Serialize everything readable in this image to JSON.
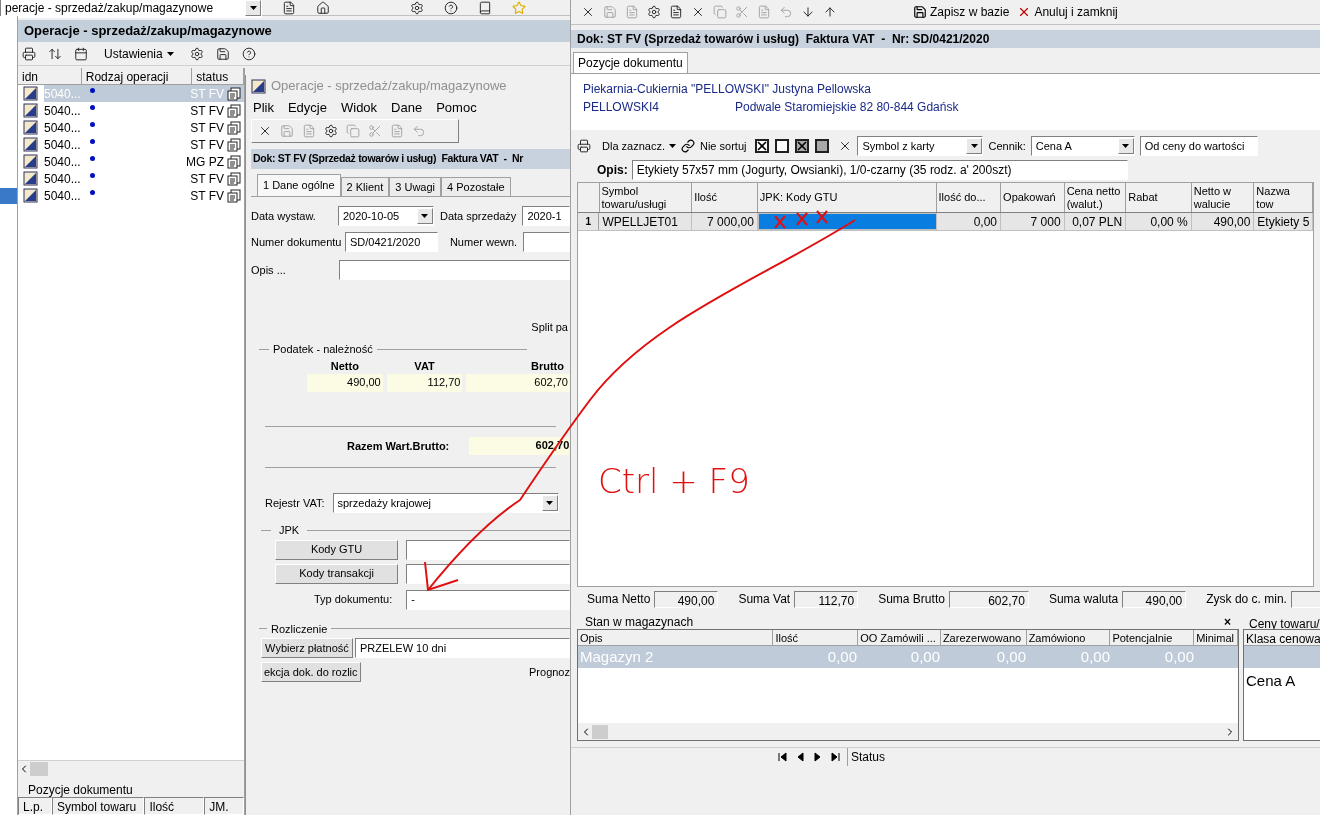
{
  "top_bar": {
    "combo_value": "peracje - sprzedaż/zakup/magazynowe"
  },
  "left_window": {
    "title": "Operacje - sprzedaż/zakup/magazynowe",
    "settings_label": "Ustawienia",
    "columns": [
      "idn",
      "Rodzaj operacji",
      "status"
    ],
    "rows": [
      {
        "idn": "5040...",
        "type": "ST FV",
        "selected": true
      },
      {
        "idn": "5040...",
        "type": "ST FV",
        "selected": false
      },
      {
        "idn": "5040...",
        "type": "ST FV",
        "selected": false
      },
      {
        "idn": "5040...",
        "type": "ST FV",
        "selected": false
      },
      {
        "idn": "5040...",
        "type": "MG PZ",
        "selected": false
      },
      {
        "idn": "5040...",
        "type": "ST FV",
        "selected": false
      },
      {
        "idn": "5040...",
        "type": "ST FV",
        "selected": false
      }
    ],
    "bottom_panel": {
      "title": "Pozycje dokumentu",
      "columns": [
        "L.p.",
        "Symbol towaru",
        "Ilość",
        "JM."
      ]
    }
  },
  "document_window": {
    "title": "Operacje - sprzedaż/zakup/magazynowe",
    "menu": [
      "Plik",
      "Edycje",
      "Widok",
      "Dane",
      "Pomoc"
    ],
    "header": "Dok: ST FV (Sprzedaż towarów i usług)  Faktura VAT  -  Nr",
    "tabs": [
      {
        "label": "1 Dane ogólne",
        "selected": true
      },
      {
        "label": "2 Klient",
        "selected": false
      },
      {
        "label": "3 Uwagi",
        "selected": false
      },
      {
        "label": "4 Pozostałe",
        "selected": false
      }
    ],
    "issue_date": {
      "label": "Data wystaw.",
      "value": "2020-10-05"
    },
    "sale_date": {
      "label": "Data sprzedaży",
      "value": "2020-1"
    },
    "doc_number": {
      "label": "Numer dokumentu",
      "value": "SD/0421/2020"
    },
    "internal_number": {
      "label": "Numer wewn."
    },
    "description": {
      "label": "Opis ..."
    },
    "split_label": "Split pa",
    "tax": {
      "title": "Podatek - należność",
      "columns": [
        "Netto",
        "VAT",
        "Brutto"
      ],
      "values": [
        "490,00",
        "112,70",
        "602,70"
      ],
      "total_label": "Razem Wart.Brutto:",
      "total": "602,70"
    },
    "vat_register": {
      "label": "Rejestr VAT:",
      "value": "sprzedaży krajowej"
    },
    "jpk": {
      "title": "JPK",
      "gtu_button": "Kody GTU",
      "transaction_button": "Kody transakcji",
      "doc_type_label": "Typ dokumentu:",
      "doc_type_value": "-"
    },
    "settlement": {
      "title": "Rozliczenie",
      "payment_button": "Wybierz płatność",
      "payment_value": "PRZELEW 10 dni",
      "selection_button": "ekcja dok. do rozlic",
      "forecast_label": "Prognoz"
    }
  },
  "items_window": {
    "save_button": "Zapisz w bazie",
    "cancel_button": "Anuluj i zamknij",
    "header": "Dok: ST FV (Sprzedaż towarów i usług)  Faktura VAT  -  Nr: SD/0421/2020",
    "tab": {
      "label": "Pozycje dokumentu",
      "selected": true
    },
    "client": {
      "name": "Piekarnia-Cukiernia \"PELLOWSKI\" Justyna Pellowska",
      "code": "PELLOWSKI4",
      "address": "Podwale Staromiejskie 82 80-844 Gdańsk"
    },
    "grid_toolbar": {
      "mark_label": "Dla zaznacz.",
      "sort_label": "Nie sortuj",
      "checkboxes": [
        {
          "kind": "check"
        },
        {
          "kind": "empty"
        },
        {
          "kind": "check-dark"
        },
        {
          "kind": "filled"
        }
      ],
      "symbol_combo": "Symbol z karty",
      "price_list_label": "Cennik:",
      "price_list_value": "Cena A",
      "range_combo": "Od ceny do wartości"
    },
    "description": {
      "label": "Opis:",
      "value": "Etykiety 57x57 mm (Jogurty, Owsianki), 1/0-czarny (35 rodz. a' 200szt)"
    },
    "columns": [
      "Symbol towaru/usługi",
      "Ilość",
      "JPK: Kody GTU",
      "Ilość do...",
      "Opakowań",
      "Cena netto (walut.)",
      "Rabat",
      "Netto w walucie",
      "Nazwa tow"
    ],
    "rows": [
      {
        "number": "1",
        "cells": [
          {
            "text": "WPELLJET01",
            "selected": false
          },
          {
            "text": "7 000,00",
            "selected": false
          },
          {
            "selected": true
          },
          {
            "text": "0,00",
            "selected": false
          },
          {
            "text": "7 000",
            "selected": false
          },
          {
            "text": "0,07 PLN",
            "selected": false
          },
          {
            "text": "0,00 %",
            "selected": false
          },
          {
            "text": "490,00",
            "selected": false
          },
          {
            "text": "Etykiety 5",
            "selected": false
          }
        ]
      }
    ],
    "sums": [
      {
        "label": "Suma Netto",
        "value": "490,00"
      },
      {
        "label": "Suma Vat",
        "value": "112,70"
      },
      {
        "label": "Suma Brutto",
        "value": "602,70"
      },
      {
        "label": "Suma waluta",
        "value": "490,00"
      },
      {
        "label": "Zysk do c. min."
      }
    ],
    "stock": {
      "title": "Stan w magazynach",
      "close": "×",
      "columns": [
        "Opis",
        "Ilość",
        "OO Zamówili ...",
        "Zarezerwowano",
        "Zamówiono",
        "Potencjalnie",
        "Minimal"
      ],
      "rows": [
        {
          "cells": [
            "Magazyn 2",
            "0,00",
            "0,00",
            "0,00",
            "0,00",
            "0,00"
          ],
          "selected": true
        }
      ]
    },
    "prices": {
      "title": "Ceny towaru/",
      "column": "Klasa cenowa",
      "value": "Cena A"
    },
    "status_bar": {
      "label": "Status"
    }
  },
  "annotation": {
    "text": "Ctrl + F9"
  }
}
